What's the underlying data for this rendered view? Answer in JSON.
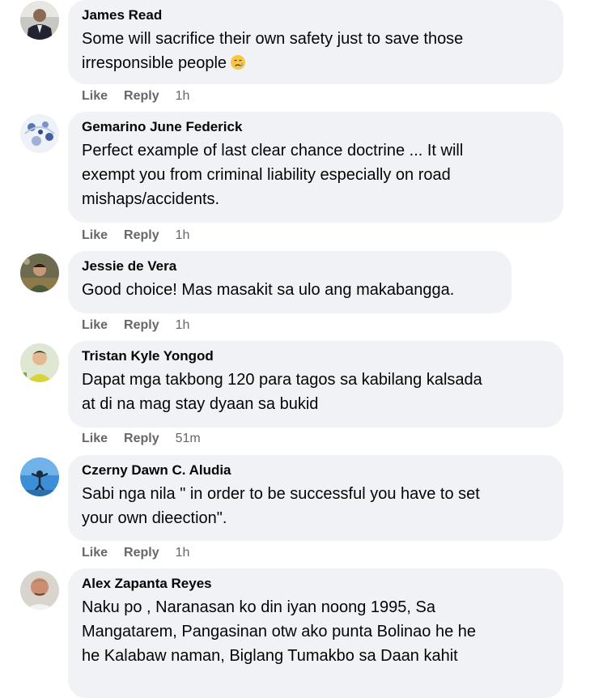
{
  "comments": [
    {
      "author": "James Read",
      "text_lines": [
        "Some will sacrifice their own safety just to save those",
        "irresponsible people"
      ],
      "emoji": "crying-face",
      "like": "Like",
      "reply": "Reply",
      "time": "1h"
    },
    {
      "author": "Gemarino June Federick",
      "text_lines": [
        "Perfect example of last clear chance doctrine ... It will",
        "exempt you from criminal liability especially on road",
        "mishaps/accidents."
      ],
      "like": "Like",
      "reply": "Reply",
      "time": "1h"
    },
    {
      "author": "Jessie de Vera",
      "text_lines": [
        "Good choice! Mas masakit sa ulo ang makabangga."
      ],
      "like": "Like",
      "reply": "Reply",
      "time": "1h"
    },
    {
      "author": "Tristan Kyle Yongod",
      "text_lines": [
        "Dapat mga takbong 120 para tagos sa kabilang kalsada",
        "at di na mag stay dyaan sa bukid"
      ],
      "like": "Like",
      "reply": "Reply",
      "time": "51m"
    },
    {
      "author": "Czerny Dawn C. Aludia",
      "text_lines": [
        "Sabi nga nila \" in order to be successful you have to set",
        "your own dieection\"."
      ],
      "like": "Like",
      "reply": "Reply",
      "time": "1h"
    },
    {
      "author": "Alex Zapanta Reyes",
      "text_lines": [
        "Naku po , Naranasan ko din iyan noong 1995, Sa",
        "Mangatarem, Pangasinan otw ako punta Bolinao he he",
        "he Kalabaw naman, Biglang Tumakbo sa Daan kahit"
      ]
    }
  ],
  "colors": {
    "bubble": "#f0f2f5",
    "author": "#050505",
    "meta": "#65676b"
  }
}
